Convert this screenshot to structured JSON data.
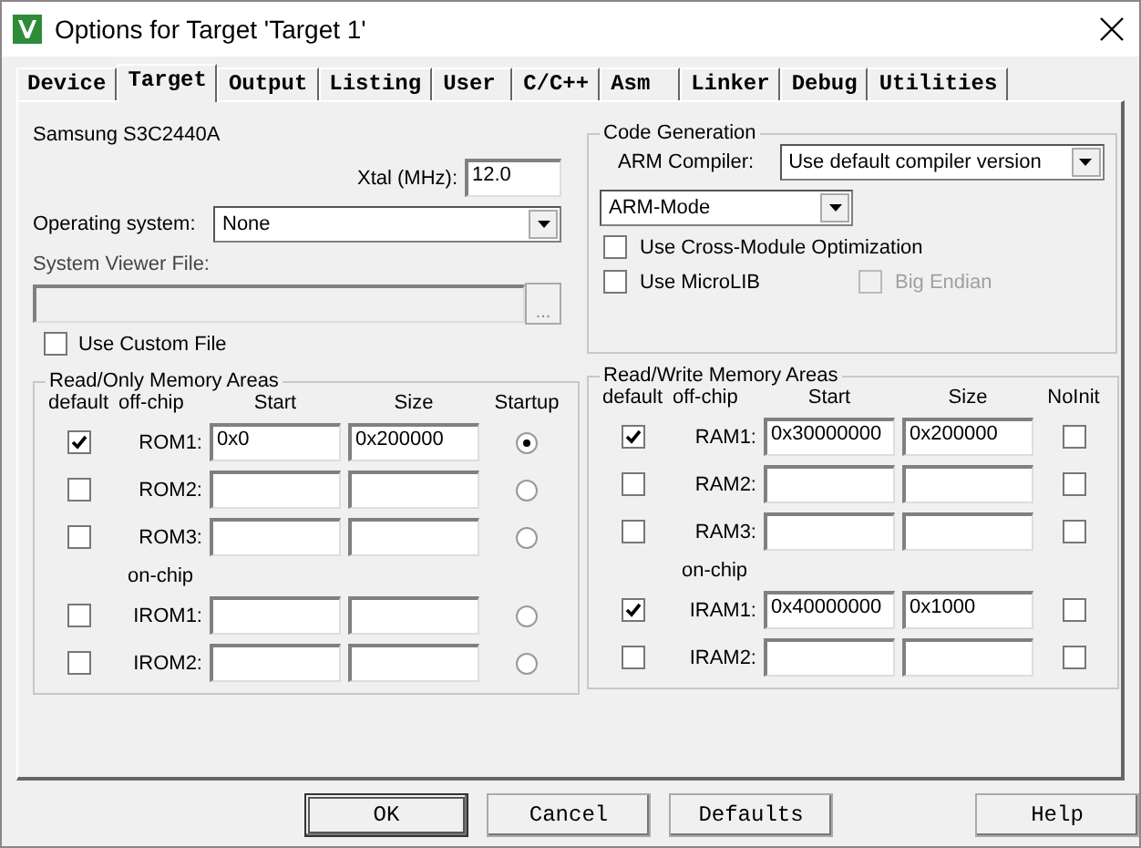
{
  "window": {
    "title": "Options for Target 'Target 1'"
  },
  "tabs": [
    {
      "label": "Device",
      "selected": false
    },
    {
      "label": "Target",
      "selected": true
    },
    {
      "label": "Output",
      "selected": false
    },
    {
      "label": "Listing",
      "selected": false
    },
    {
      "label": "User",
      "selected": false
    },
    {
      "label": "C/C++",
      "selected": false
    },
    {
      "label": "Asm",
      "selected": false
    },
    {
      "label": "Linker",
      "selected": false
    },
    {
      "label": "Debug",
      "selected": false
    },
    {
      "label": "Utilities",
      "selected": false
    }
  ],
  "device": "Samsung S3C2440A",
  "xtal": {
    "label": "Xtal (MHz):",
    "value": "12.0"
  },
  "operating_system": {
    "label": "Operating system:",
    "value": "None"
  },
  "system_viewer_file": {
    "label": "System Viewer File:",
    "browse": "...",
    "disabled": true
  },
  "use_custom_file": {
    "label": "Use Custom File",
    "checked": false
  },
  "code_generation": {
    "title": "Code Generation",
    "compiler_label": "ARM Compiler:",
    "compiler_value": "Use default compiler version",
    "mode_value": "ARM-Mode",
    "options": [
      {
        "label": "Use Cross-Module Optimization",
        "checked": false,
        "disabled": false
      },
      {
        "label": "Use MicroLIB",
        "checked": false,
        "disabled": false
      },
      {
        "label": "Big Endian",
        "checked": false,
        "disabled": true
      }
    ]
  },
  "rom": {
    "title": "Read/Only Memory Areas",
    "columns": [
      "default",
      "off-chip",
      "Start",
      "Size",
      "Startup"
    ],
    "rows": [
      {
        "kind": "area",
        "name": "ROM1:",
        "default": true,
        "start": "0x0",
        "size": "0x200000",
        "selected": true
      },
      {
        "kind": "area",
        "name": "ROM2:",
        "default": false,
        "selected": false
      },
      {
        "kind": "area",
        "name": "ROM3:",
        "default": false,
        "selected": false
      },
      {
        "kind": "heading",
        "label": "on-chip"
      },
      {
        "kind": "area",
        "name": "IROM1:",
        "default": false,
        "selected": false
      },
      {
        "kind": "area",
        "name": "IROM2:",
        "default": false,
        "selected": false
      }
    ]
  },
  "ram": {
    "title": "Read/Write Memory Areas",
    "columns": [
      "default",
      "off-chip",
      "Start",
      "Size",
      "NoInit"
    ],
    "rows": [
      {
        "kind": "area",
        "name": "RAM1:",
        "default": true,
        "start": "0x30000000",
        "size": "0x200000",
        "noinit": false
      },
      {
        "kind": "area",
        "name": "RAM2:",
        "default": false,
        "noinit": false
      },
      {
        "kind": "area",
        "name": "RAM3:",
        "default": false,
        "noinit": false
      },
      {
        "kind": "heading",
        "label": "on-chip"
      },
      {
        "kind": "area",
        "name": "IRAM1:",
        "default": true,
        "start": "0x40000000",
        "size": "0x1000",
        "noinit": false
      },
      {
        "kind": "area",
        "name": "IRAM2:",
        "default": false,
        "noinit": false
      }
    ]
  },
  "buttons": [
    {
      "label": "OK",
      "default": true
    },
    {
      "label": "Cancel",
      "default": false
    },
    {
      "label": "Defaults",
      "default": false
    },
    {
      "label": "Help",
      "default": false
    }
  ]
}
